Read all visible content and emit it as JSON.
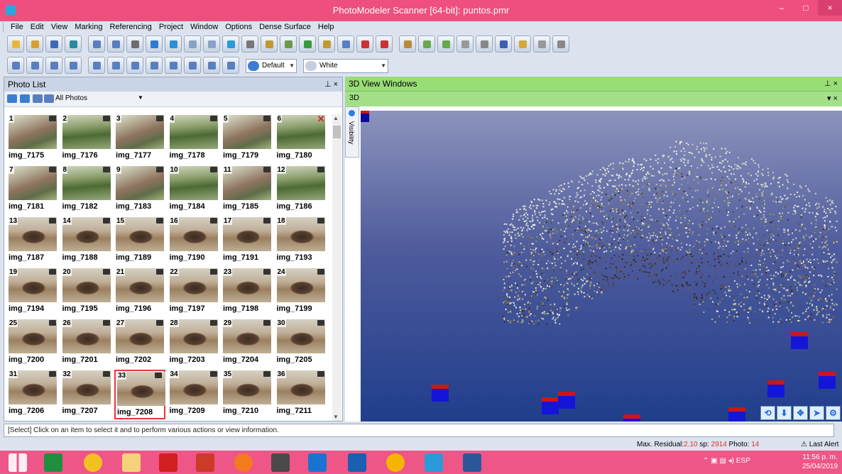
{
  "window": {
    "title": "PhotoModeler Scanner [64-bit]: puntos.pmr",
    "minimize": "–",
    "maximize": "□",
    "close": "×"
  },
  "menu": [
    "File",
    "Edit",
    "View",
    "Marking",
    "Referencing",
    "Project",
    "Window",
    "Options",
    "Dense Surface",
    "Help"
  ],
  "toolbar2": {
    "color_scheme": "Default",
    "background": "White"
  },
  "photo_list": {
    "title": "Photo List",
    "filter": "All Photos",
    "photos": [
      {
        "n": "1",
        "name": "img_7175"
      },
      {
        "n": "2",
        "name": "img_7176"
      },
      {
        "n": "3",
        "name": "img_7177"
      },
      {
        "n": "4",
        "name": "img_7178"
      },
      {
        "n": "5",
        "name": "img_7179"
      },
      {
        "n": "6",
        "name": "img_7180"
      },
      {
        "n": "7",
        "name": "img_7181"
      },
      {
        "n": "8",
        "name": "img_7182"
      },
      {
        "n": "9",
        "name": "img_7183"
      },
      {
        "n": "10",
        "name": "img_7184"
      },
      {
        "n": "11",
        "name": "img_7185"
      },
      {
        "n": "12",
        "name": "img_7186"
      },
      {
        "n": "13",
        "name": "img_7187"
      },
      {
        "n": "14",
        "name": "img_7188"
      },
      {
        "n": "15",
        "name": "img_7189"
      },
      {
        "n": "16",
        "name": "img_7190"
      },
      {
        "n": "17",
        "name": "img_7191"
      },
      {
        "n": "18",
        "name": "img_7193"
      },
      {
        "n": "19",
        "name": "img_7194"
      },
      {
        "n": "20",
        "name": "img_7195"
      },
      {
        "n": "21",
        "name": "img_7196"
      },
      {
        "n": "22",
        "name": "img_7197"
      },
      {
        "n": "23",
        "name": "img_7198"
      },
      {
        "n": "24",
        "name": "img_7199"
      },
      {
        "n": "25",
        "name": "img_7200"
      },
      {
        "n": "26",
        "name": "img_7201"
      },
      {
        "n": "27",
        "name": "img_7202"
      },
      {
        "n": "28",
        "name": "img_7203"
      },
      {
        "n": "29",
        "name": "img_7204"
      },
      {
        "n": "30",
        "name": "img_7205"
      },
      {
        "n": "31",
        "name": "img_7206"
      },
      {
        "n": "32",
        "name": "img_7207"
      },
      {
        "n": "33",
        "name": "img_7208"
      },
      {
        "n": "34",
        "name": "img_7209"
      },
      {
        "n": "35",
        "name": "img_7210"
      },
      {
        "n": "36",
        "name": "img_7211"
      }
    ],
    "selected": "33"
  },
  "view3d": {
    "title": "3D View Windows",
    "subtitle": "3D",
    "visibility": "Visibility"
  },
  "status": "[Select] Click on an item to select it and to perform various actions or view information.",
  "info": {
    "residual_label": "Max. Residual:",
    "residual": "2.10",
    "sp_label": "sp:",
    "sp": "2914",
    "photo_label": "Photo:",
    "photo": "14",
    "alert": "Last Alert"
  },
  "taskbar": {
    "lang": "ESP",
    "time": "11:56 p. m.",
    "date": "25/04/2019"
  }
}
